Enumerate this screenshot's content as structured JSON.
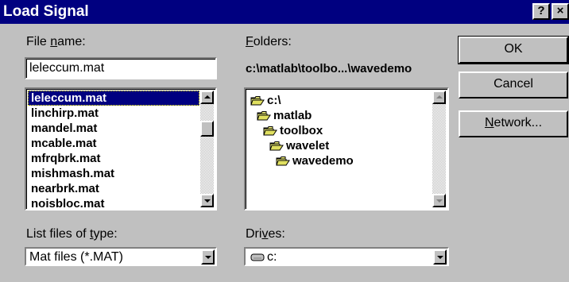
{
  "window": {
    "title": "Load Signal",
    "help_button": "?",
    "close_button": "×"
  },
  "file_name": {
    "label_pre": "File ",
    "label_accel": "n",
    "label_post": "ame:",
    "value": "leleccum.mat",
    "files": [
      "leleccum.mat",
      "linchirp.mat",
      "mandel.mat",
      "mcable.mat",
      "mfrqbrk.mat",
      "mishmash.mat",
      "nearbrk.mat",
      "noisbloc.mat"
    ],
    "selected_index": 0
  },
  "folders": {
    "label_accel": "F",
    "label_post": "olders:",
    "current_path": "c:\\matlab\\toolbo...\\wavedemo",
    "tree": [
      {
        "name": "c:\\",
        "level": 0,
        "open": true
      },
      {
        "name": "matlab",
        "level": 1,
        "open": true
      },
      {
        "name": "toolbox",
        "level": 2,
        "open": true
      },
      {
        "name": "wavelet",
        "level": 3,
        "open": true
      },
      {
        "name": "wavedemo",
        "level": 4,
        "open": true
      }
    ]
  },
  "file_type": {
    "label_pre": "List files of ",
    "label_accel": "t",
    "label_post": "ype:",
    "value": "Mat files (*.MAT)"
  },
  "drives": {
    "label_pre": "Dri",
    "label_accel": "v",
    "label_post": "es:",
    "value": "c:"
  },
  "buttons": {
    "ok": "OK",
    "cancel": "Cancel",
    "network_accel": "N",
    "network_post": "etwork..."
  }
}
